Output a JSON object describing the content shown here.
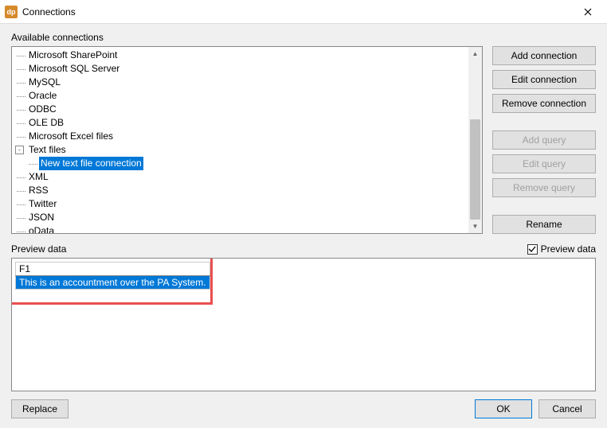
{
  "titlebar": {
    "icon_text": "dp",
    "title": "Connections"
  },
  "available_label": "Available connections",
  "tree": {
    "items": [
      {
        "label": "Microsoft SharePoint",
        "indent": 1
      },
      {
        "label": "Microsoft SQL Server",
        "indent": 1
      },
      {
        "label": "MySQL",
        "indent": 1
      },
      {
        "label": "Oracle",
        "indent": 1
      },
      {
        "label": "ODBC",
        "indent": 1
      },
      {
        "label": "OLE DB",
        "indent": 1
      },
      {
        "label": "Microsoft Excel files",
        "indent": 1
      },
      {
        "label": "Text files",
        "indent": 1,
        "toggle": "-"
      },
      {
        "label": "New text file connection",
        "indent": 2,
        "selected": true,
        "leaf": true
      },
      {
        "label": "XML",
        "indent": 1
      },
      {
        "label": "RSS",
        "indent": 1
      },
      {
        "label": "Twitter",
        "indent": 1
      },
      {
        "label": "JSON",
        "indent": 1
      },
      {
        "label": "oData",
        "indent": 1
      }
    ]
  },
  "buttons": {
    "add_connection": "Add connection",
    "edit_connection": "Edit connection",
    "remove_connection": "Remove connection",
    "add_query": "Add query",
    "edit_query": "Edit query",
    "remove_query": "Remove query",
    "rename": "Rename"
  },
  "preview": {
    "label": "Preview data",
    "checkbox_label": "Preview data",
    "col_header": "F1",
    "row_value": "This is an accountment over the PA System."
  },
  "footer": {
    "replace": "Replace",
    "ok": "OK",
    "cancel": "Cancel"
  },
  "scrollbar": {
    "thumb_top_pct": 37,
    "thumb_height_pct": 63
  }
}
